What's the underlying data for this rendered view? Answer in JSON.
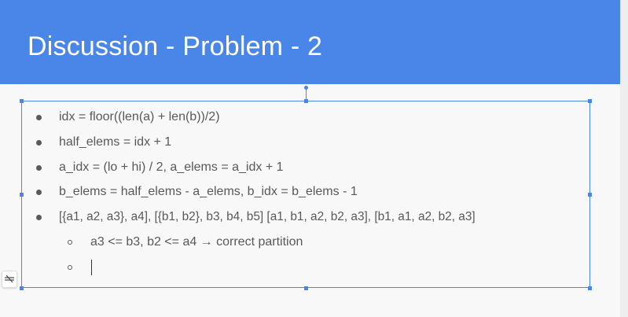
{
  "slide": {
    "title": "Discussion - Problem - 2"
  },
  "bullets": [
    "idx = floor((len(a) + len(b))/2)",
    "half_elems = idx + 1",
    "a_idx = (lo + hi) / 2, a_elems = a_idx + 1",
    "b_elems = half_elems - a_elems, b_idx = b_elems - 1",
    "[{a1, a2, a3}, a4], [{b1, b2}, b3, b4, b5] [a1, b1, a2, b2, a3], [b1, a1, a2, b2, a3]"
  ],
  "sub_bullets": [
    "a3 <= b3, b2 <= a4 → correct partition",
    ""
  ],
  "icons": {
    "side_tool": "hide-format-icon"
  },
  "colors": {
    "header": "#4a86e8",
    "selection": "#4a86e8",
    "text": "#595959"
  }
}
